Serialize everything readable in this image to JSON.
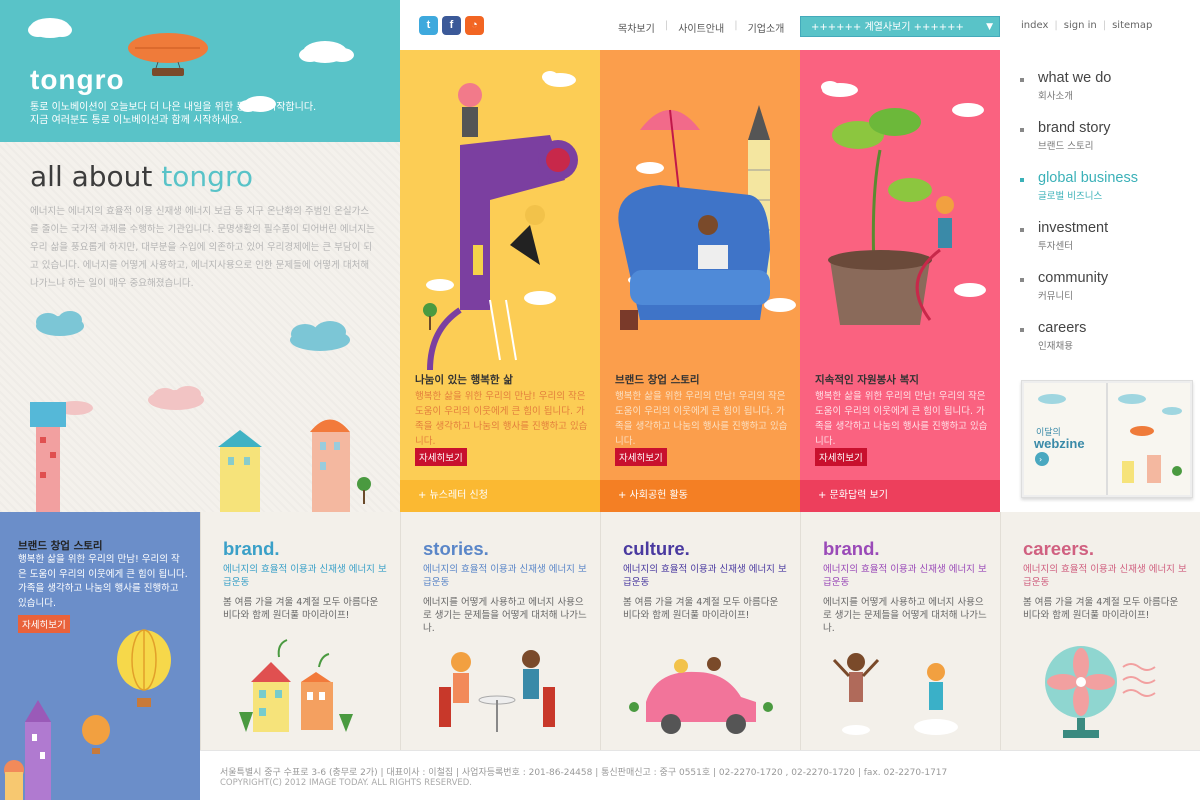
{
  "header": {
    "logo": "tongro",
    "slogan_lines": [
      "통로 이노베이션이 오늘보다 더 나은 내일을 위한 동행을 시작합니다.",
      "지금 여러분도 통로 이노베이션과 함께 시작하세요."
    ],
    "social": [
      {
        "icon": "twitter-icon",
        "glyph": "t",
        "color": "#3ea9dd"
      },
      {
        "icon": "facebook-icon",
        "glyph": "f",
        "color": "#3b5998"
      },
      {
        "icon": "rss-icon",
        "glyph": "◔",
        "color": "#f26522"
      }
    ],
    "menu": [
      "목차보기",
      "사이트안내",
      "기업소개"
    ],
    "family_select": "++++++ 계열사보기 ++++++",
    "util": [
      "index",
      "sign in",
      "sitemap"
    ]
  },
  "about": {
    "title_a": "all about",
    "title_b": "tongro",
    "text": "에너지는 에너지의 효율적 이용 신재생 에너지 보급 등 지구 온난화의 주범인 온실가스를 줄이는 국가적 과제를 수행하는 기관입니다. 문명생활의 필수품이 되어버린 에너지는 우리 삶을 풍요롭게 하지만, 대부분을 수입에 의존하고 있어 우리경제에는 큰 부담이 되고 있습니다. 에너지를 어떻게 사용하고, 에너지사용으로 인한 문제들에 어떻게 대처해나가느냐 하는 일이 매우 중요해졌습니다."
  },
  "features": [
    {
      "title": "나눔이 있는 행복한 삶",
      "desc": "행복한 삶을 위한 우리의 만남! 우리의 작은 도움이 우리의 이웃에게 큰 힘이 됩니다. 가족을 생각하고 나눔의 행사를 진행하고 있습니다.",
      "button": "자세히보기",
      "bar": "+   뉴스레터 신청",
      "bg": "#fccd55",
      "barbg": "#fbb932",
      "desccolor": "#e37f3c"
    },
    {
      "title": "브랜드 창업 스토리",
      "desc": "행복한 삶을 위한 우리의 만남! 우리의 작은 도움이 우리의 이웃에게 큰 힘이 됩니다. 가족을 생각하고 나눔의 행사를 진행하고 있습니다.",
      "button": "자세히보기",
      "bar": "+   사회공헌 활동",
      "bg": "#fb9e4c",
      "barbg": "#f47f24",
      "desccolor": "#fbe0c2"
    },
    {
      "title": "지속적인 자원봉사 복지",
      "desc": "행복한 삶을 위한 우리의 만남! 우리의 작은 도움이 우리의 이웃에게 큰 힘이 됩니다. 가족을 생각하고 나눔의 행사를 진행하고 있습니다.",
      "button": "자세히보기",
      "bar": "+   문화답력 보기",
      "bg": "#fa6280",
      "barbg": "#ed3f5c",
      "desccolor": "#ffe0e6"
    }
  ],
  "rnav": [
    {
      "en": "what we do",
      "ko": "회사소개",
      "active": false
    },
    {
      "en": "brand story",
      "ko": "브랜드 스토리",
      "active": false
    },
    {
      "en": "global business",
      "ko": "글로벌 비즈니스",
      "active": true
    },
    {
      "en": "investment",
      "ko": "투자센터",
      "active": false
    },
    {
      "en": "community",
      "ko": "커뮤니티",
      "active": false
    },
    {
      "en": "careers",
      "ko": "인재채용",
      "active": false
    }
  ],
  "webzine": {
    "line1": "이달의",
    "line2": "webzine"
  },
  "bluebox": {
    "title": "브랜드 창업 스토리",
    "text": "행복한 삶을 위한 우리의 만남! 우리의 작은 도움이 우리의 이웃에게 큰 힘이 됩니다. 가족을 생각하고 나눔의 행사를 진행하고 있습니다.",
    "button": "자세히보기"
  },
  "cards": [
    {
      "title": "brand.",
      "color": "#3aa0c8",
      "sub": "에너지의 효율적 이용과 신재생 에너지 보급운동",
      "desc": "봄 여름 가을 겨울 4계절 모두 아름다운 비다와 함께 원더풀 마이라이프!"
    },
    {
      "title": "stories.",
      "color": "#5a86c8",
      "sub": "에너지의 효율적 이용과 신재생 에너지 보급운동",
      "desc": "에너지를 어떻게 사용하고 에너지 사용으로 생기는 문제들을 어떻게 대처해 나가느나."
    },
    {
      "title": "culture.",
      "color": "#4a3aa0",
      "sub": "에너지의 효율적 이용과 신재생 에너지 보급운동",
      "desc": "봄 여름 가을 겨울 4계절 모두 아름다운 비다와 함께 원더풀 마이라이프!"
    },
    {
      "title": "brand.",
      "color": "#9a4ab8",
      "sub": "에너지의 효율적 이용과 신재생 에너지 보급운동",
      "desc": "에너지를 어떻게 사용하고 에너지 사용으로 생기는 문제들을 어떻게 대처해 나가느나."
    },
    {
      "title": "careers.",
      "color": "#d06080",
      "sub": "에너지의 효율적 이용과 신재생 에너지 보급운동",
      "desc": "봄 여름 가을 겨울 4계절 모두 아름다운 비다와 함께 원더풀 마이라이프!"
    }
  ],
  "footer": {
    "line": "서울특별시 중구 수표로 3-6 (충무로 2가)   |   대표이사 : 이철집   |   사업자등록번호 : 201-86-24458   |   통신판매신고 : 중구 0551호   |   02-2270-1720 , 02-2270-1720   |   fax. 02-2270-1717",
    "copy": "COPYRIGHT(C) 2012 IMAGE TODAY. ALL RIGHTS RESERVED."
  }
}
